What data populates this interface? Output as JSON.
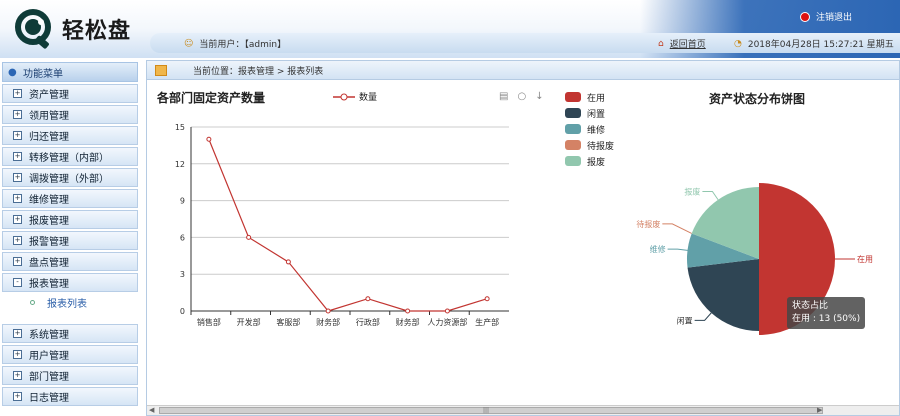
{
  "header": {
    "logo_text": "轻松盘",
    "logout_label": "注销退出",
    "user_label": "当前用户：【admin】",
    "home_label": "返回首页",
    "datetime": "2018年04月28日 15:27:21 星期五"
  },
  "sidebar": {
    "title": "功能菜单",
    "items": [
      {
        "label": "资产管理",
        "box": "+"
      },
      {
        "label": "领用管理",
        "box": "+"
      },
      {
        "label": "归还管理",
        "box": "+"
      },
      {
        "label": "转移管理（内部）",
        "box": "+"
      },
      {
        "label": "调拨管理（外部）",
        "box": "+"
      },
      {
        "label": "维修管理",
        "box": "+"
      },
      {
        "label": "报废管理",
        "box": "+"
      },
      {
        "label": "报警管理",
        "box": "+"
      },
      {
        "label": "盘点管理",
        "box": "+"
      },
      {
        "label": "报表管理",
        "box": "-"
      }
    ],
    "sub_item": "报表列表",
    "items_bottom": [
      {
        "label": "系统管理",
        "box": "+"
      },
      {
        "label": "用户管理",
        "box": "+"
      },
      {
        "label": "部门管理",
        "box": "+"
      },
      {
        "label": "日志管理",
        "box": "+"
      }
    ]
  },
  "breadcrumb": "当前位置：报表管理 > 报表列表",
  "line_chart_ui": {
    "title": "各部门固定资产数量",
    "legend_label": "数量",
    "toolbox": [
      "▤",
      "○",
      "↓"
    ]
  },
  "pie_chart_ui": {
    "title": "资产状态分布饼图",
    "tooltip_title": "状态占比",
    "tooltip_value": "在用 : 13 (50%)"
  },
  "chart_data": [
    {
      "type": "line",
      "title": "各部门固定资产数量",
      "categories": [
        "销售部",
        "开发部",
        "客服部",
        "财务部",
        "行政部",
        "财务部",
        "人力资源部",
        "生产部"
      ],
      "series": [
        {
          "name": "数量",
          "values": [
            14,
            6,
            4,
            0,
            1,
            0,
            0,
            1
          ]
        }
      ],
      "ylim": [
        0,
        15
      ],
      "yticks": [
        0,
        3,
        6,
        9,
        12,
        15
      ],
      "grid": true,
      "color": "#c23531"
    },
    {
      "type": "pie",
      "title": "资产状态分布饼图",
      "slices": [
        {
          "name": "在用",
          "value": 13,
          "color": "#c23531"
        },
        {
          "name": "闲置",
          "value": 6,
          "color": "#2f4554"
        },
        {
          "name": "维修",
          "value": 2,
          "color": "#61a0a8"
        },
        {
          "name": "待报废",
          "value": 0,
          "color": "#d48265"
        },
        {
          "name": "报废",
          "value": 5,
          "color": "#91c7ae"
        }
      ],
      "legend_position": "left"
    }
  ]
}
